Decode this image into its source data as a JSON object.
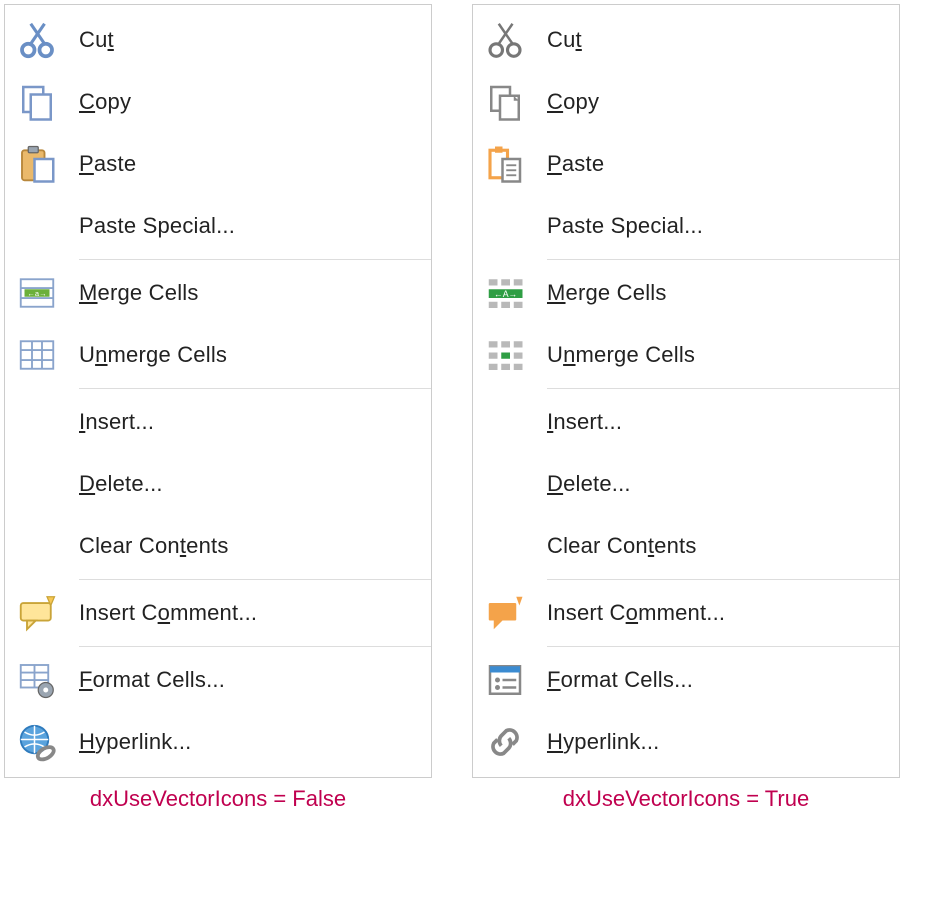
{
  "menus": {
    "left": {
      "caption": "dxUseVectorIcons = False",
      "items": [
        {
          "key": "cut",
          "label": "Cut",
          "ul": [
            2
          ],
          "icon": "cut-bitmap"
        },
        {
          "key": "copy",
          "label": "Copy",
          "ul": [
            0
          ],
          "icon": "copy-bitmap"
        },
        {
          "key": "paste",
          "label": "Paste",
          "ul": [
            0
          ],
          "icon": "paste-bitmap"
        },
        {
          "key": "paste-special",
          "label": "Paste Special...",
          "ul": [],
          "icon": ""
        },
        {
          "sep": true
        },
        {
          "key": "merge",
          "label": "Merge Cells",
          "ul": [
            0
          ],
          "icon": "merge-bitmap"
        },
        {
          "key": "unmerge",
          "label": "Unmerge Cells",
          "ul": [
            1
          ],
          "icon": "unmerge-bitmap"
        },
        {
          "sep": true
        },
        {
          "key": "insert",
          "label": "Insert...",
          "ul": [
            0
          ],
          "icon": ""
        },
        {
          "key": "delete",
          "label": "Delete...",
          "ul": [
            0
          ],
          "icon": ""
        },
        {
          "key": "clear",
          "label": "Clear Contents",
          "ul": [
            9
          ],
          "icon": ""
        },
        {
          "sep": true
        },
        {
          "key": "comment",
          "label": "Insert Comment...",
          "ul": [
            8
          ],
          "icon": "comment-bitmap"
        },
        {
          "sep": true
        },
        {
          "key": "format",
          "label": "Format Cells...",
          "ul": [
            0
          ],
          "icon": "format-bitmap"
        },
        {
          "key": "hyperlink",
          "label": "Hyperlink...",
          "ul": [
            0
          ],
          "icon": "hyperlink-bitmap"
        }
      ]
    },
    "right": {
      "caption": "dxUseVectorIcons = True",
      "items": [
        {
          "key": "cut",
          "label": "Cut",
          "ul": [
            2
          ],
          "icon": "cut-vector"
        },
        {
          "key": "copy",
          "label": "Copy",
          "ul": [
            0
          ],
          "icon": "copy-vector"
        },
        {
          "key": "paste",
          "label": "Paste",
          "ul": [
            0
          ],
          "icon": "paste-vector"
        },
        {
          "key": "paste-special",
          "label": "Paste Special...",
          "ul": [],
          "icon": ""
        },
        {
          "sep": true
        },
        {
          "key": "merge",
          "label": "Merge Cells",
          "ul": [
            0
          ],
          "icon": "merge-vector"
        },
        {
          "key": "unmerge",
          "label": "Unmerge Cells",
          "ul": [
            1
          ],
          "icon": "unmerge-vector"
        },
        {
          "sep": true
        },
        {
          "key": "insert",
          "label": "Insert...",
          "ul": [
            0
          ],
          "icon": ""
        },
        {
          "key": "delete",
          "label": "Delete...",
          "ul": [
            0
          ],
          "icon": ""
        },
        {
          "key": "clear",
          "label": "Clear Contents",
          "ul": [
            9
          ],
          "icon": ""
        },
        {
          "sep": true
        },
        {
          "key": "comment",
          "label": "Insert Comment...",
          "ul": [
            8
          ],
          "icon": "comment-vector"
        },
        {
          "sep": true
        },
        {
          "key": "format",
          "label": "Format Cells...",
          "ul": [
            0
          ],
          "icon": "format-vector"
        },
        {
          "key": "hyperlink",
          "label": "Hyperlink...",
          "ul": [
            0
          ],
          "icon": "hyperlink-vector"
        }
      ]
    }
  }
}
